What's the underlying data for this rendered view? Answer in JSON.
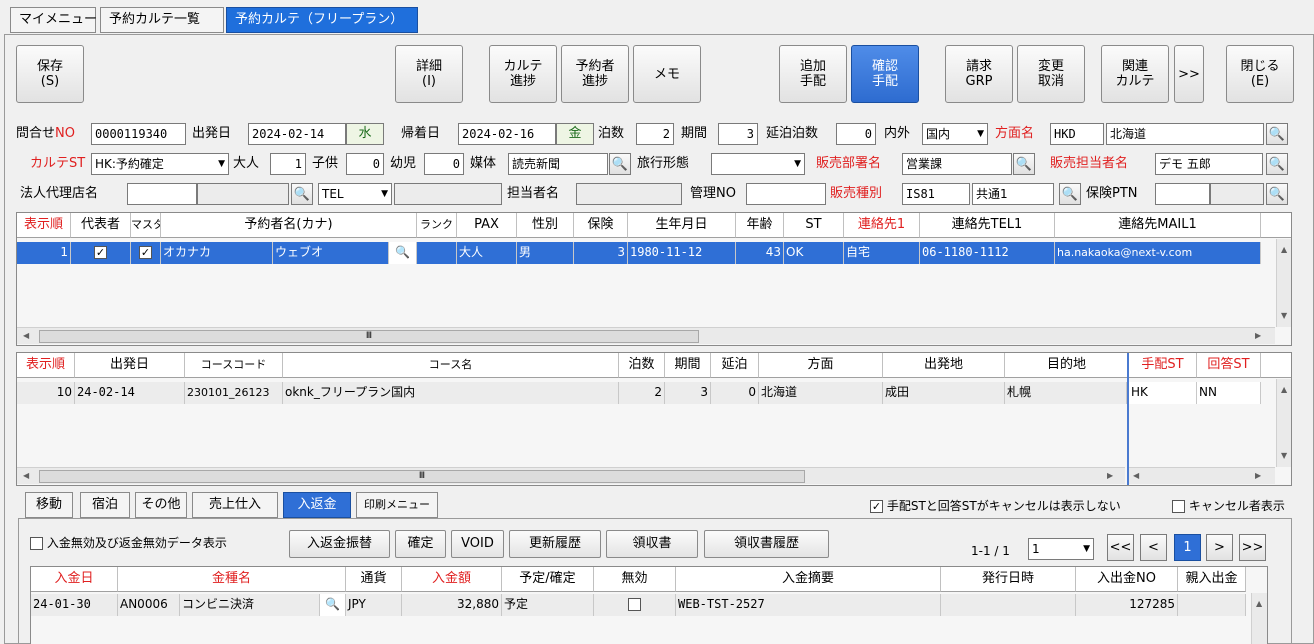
{
  "tabs": [
    "マイメニュー",
    "予約カルテ一覧",
    "予約カルテ（フリープラン）"
  ],
  "toolbar": {
    "save": "保存\n(S)",
    "detail": "詳細\n(I)",
    "karte_progress": "カルテ\n進捗",
    "booker_progress": "予約者\n進捗",
    "memo": "メモ",
    "add_arrange": "追加\n手配",
    "confirm_arrange": "確認\n手配",
    "invoice_grp": "請求\nGRP",
    "change_cancel": "変更\n取消",
    "related_karte": "関連\nカルテ",
    "more": ">>",
    "close": "閉じる\n(E)"
  },
  "form": {
    "inquiry_no_label": "問合せNO",
    "inquiry_no": "0000119340",
    "departure_label": "出発日",
    "departure_date": "2024-02-14",
    "departure_day": "水",
    "return_label": "帰着日",
    "return_date": "2024-02-16",
    "return_day": "金",
    "nights_label": "泊数",
    "nights": "2",
    "period_label": "期間",
    "period": "3",
    "extended_label": "延泊泊数",
    "extended": "0",
    "domestic_label": "内外",
    "domestic": "国内",
    "direction_label": "方面名",
    "direction_code": "HKD",
    "direction_name": "北海道",
    "karte_st_label": "カルテST",
    "karte_st": "HK:予約確定",
    "adult_label": "大人",
    "adult": "1",
    "child_label": "子供",
    "child": "0",
    "infant_label": "幼児",
    "infant": "0",
    "media_label": "媒体",
    "media": "読売新聞",
    "travel_form_label": "旅行形態",
    "travel_form": "",
    "sales_dept_label": "販売部署名",
    "sales_dept": "営業課",
    "sales_person_label": "販売担当者名",
    "sales_person": "デモ 五郎",
    "corp_agency_label": "法人代理店名",
    "corp_agency": "",
    "tel_select": "TEL",
    "tel_value": "",
    "person_label": "担当者名",
    "person": "",
    "manage_no_label": "管理NO",
    "manage_no": "",
    "sales_type_label": "販売種別",
    "sales_type_code": "IS81",
    "sales_type_name": "共通1",
    "insurance_label": "保険PTN",
    "insurance": ""
  },
  "booker_grid": {
    "headers": [
      "表示順",
      "代表者",
      "マスタ",
      "予約者名(カナ)",
      "ランク",
      "PAX",
      "性別",
      "保険",
      "生年月日",
      "年齢",
      "ST",
      "連絡先1",
      "連絡先TEL1",
      "連絡先MAIL1"
    ],
    "row": {
      "order": "1",
      "rep": "✓",
      "master": "✓",
      "name_last": "オカナカ",
      "name_first": "ウェブオ",
      "rank": "",
      "pax": "大人",
      "gender": "男",
      "insurance": "3",
      "birth": "1980-11-12",
      "age": "43",
      "st": "OK",
      "contact": "自宅",
      "tel": "06-1180-1112",
      "mail": "ha.nakaoka@next-v.com"
    }
  },
  "course_grid": {
    "headers": [
      "表示順",
      "出発日",
      "コースコード",
      "コース名",
      "泊数",
      "期間",
      "延泊",
      "方面",
      "出発地",
      "目的地",
      "手配ST",
      "回答ST"
    ],
    "row": {
      "order": "10",
      "departure": "24-02-14",
      "code": "230101_26123",
      "name": "oknk_フリープラン国内",
      "nights": "2",
      "period": "3",
      "extended": "0",
      "direction": "北海道",
      "origin": "成田",
      "destination": "札幌",
      "arrange_st": "HK",
      "answer_st": "NN"
    }
  },
  "bottom_tabs": [
    "移動",
    "宿泊",
    "その他",
    "売上仕入",
    "入返金",
    "印刷メニュー"
  ],
  "options": {
    "hide_cancel": "手配STと回答STがキャンセルは表示しない",
    "show_cancel_person": "キャンセル者表示"
  },
  "payment": {
    "show_invalid": "入金無効及び返金無効データ表示",
    "transfer": "入返金振替",
    "confirm": "確定",
    "void": "VOID",
    "history": "更新履歴",
    "receipt": "領収書",
    "receipt_history": "領収書履歴",
    "page_info": "1-1 / 1",
    "page_select": "1",
    "page_first": "<<",
    "page_prev": "<",
    "page_current": "1",
    "page_next": ">",
    "page_last": ">>",
    "headers": [
      "入金日",
      "金種名",
      "通貨",
      "入金額",
      "予定/確定",
      "無効",
      "入金摘要",
      "発行日時",
      "入出金NO",
      "親入出金"
    ],
    "row": {
      "date": "24-01-30",
      "code": "AN0006",
      "kind": "コンビニ決済",
      "currency": "JPY",
      "amount": "32,880",
      "plan": "予定",
      "summary": "WEB-TST-2527",
      "issued": "",
      "no": "127285",
      "parent": ""
    }
  },
  "colors": {
    "accent": "#2f6fd6",
    "label_red": "#e02020"
  }
}
